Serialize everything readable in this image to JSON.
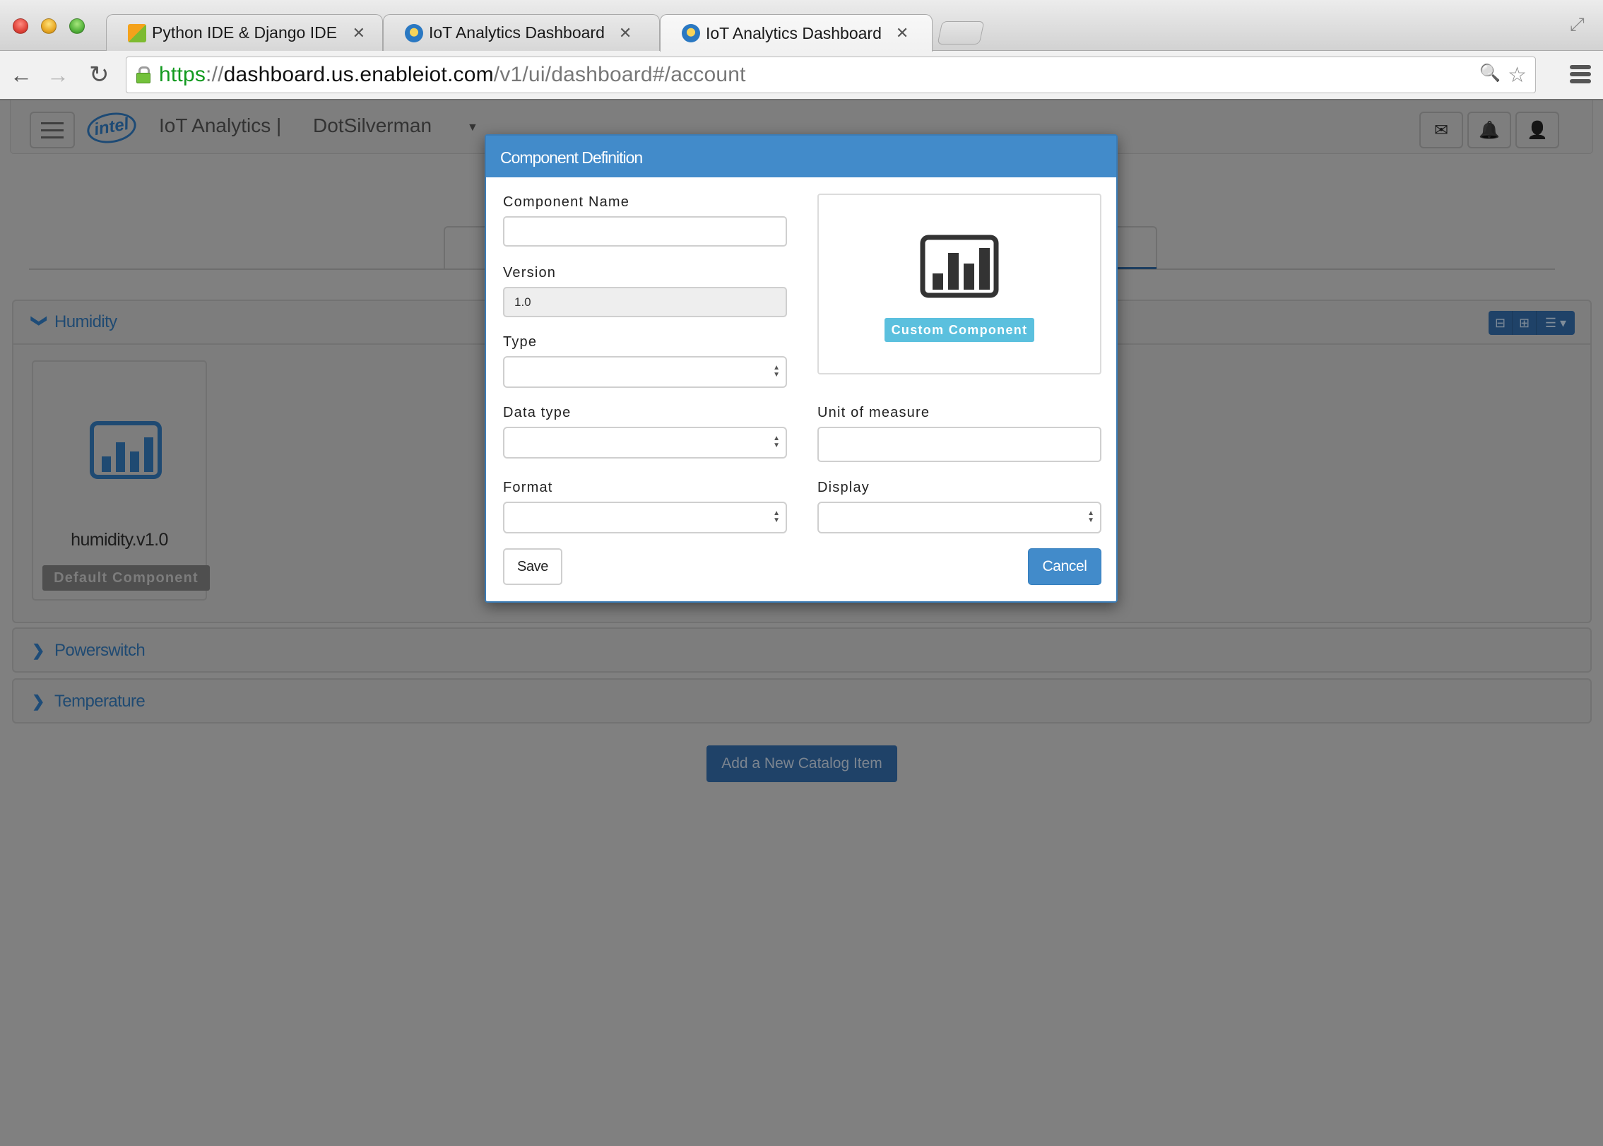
{
  "browser": {
    "tabs": [
      {
        "title": "Python IDE & Django IDE fo",
        "favicon": "pycharm-icon",
        "active": false
      },
      {
        "title": "IoT Analytics Dashboard",
        "favicon": "iot-icon",
        "active": false
      },
      {
        "title": "IoT Analytics Dashboard",
        "favicon": "iot-icon",
        "active": true
      }
    ],
    "tab_close_glyph": "✕",
    "url": {
      "scheme": "https",
      "separator": "://",
      "host": "dashboard.us.enableiot.com",
      "path": "/v1/ui/dashboard#/account"
    },
    "icons": {
      "back": "←",
      "forward": "→",
      "reload": "↻",
      "zoom": "🔍",
      "bookmark": "☆",
      "fullscreen": "⤢"
    }
  },
  "app_header": {
    "logo_text": "intel",
    "brand": "IoT Analytics |",
    "account_name": "DotSilverman",
    "account_caret": "▼",
    "icons": {
      "mail": "✉",
      "bell": "🔔",
      "user": "👤"
    }
  },
  "catalog": {
    "panels": [
      {
        "title": "Humidity",
        "expanded": true,
        "chevron": "❯"
      },
      {
        "title": "Powerswitch",
        "expanded": false,
        "chevron": "❯"
      },
      {
        "title": "Temperature",
        "expanded": false,
        "chevron": "❯"
      }
    ],
    "panel_tools": {
      "collapse": "⊟",
      "expand": "⊞",
      "list": "☰ ▾"
    },
    "components": [
      {
        "name": "humidity.v1.0",
        "badge": "Default Component"
      }
    ],
    "add_button": "Add a New Catalog Item"
  },
  "modal": {
    "title": "Component Definition",
    "fields": {
      "component_name": {
        "label": "Component Name",
        "value": "",
        "placeholder": ""
      },
      "version": {
        "label": "Version",
        "value": "1.0"
      },
      "type": {
        "label": "Type",
        "value": ""
      },
      "data_type": {
        "label": "Data type",
        "value": ""
      },
      "unit_of_measure": {
        "label": "Unit of measure",
        "value": "",
        "placeholder": ""
      },
      "format": {
        "label": "Format",
        "value": ""
      },
      "display": {
        "label": "Display",
        "value": ""
      }
    },
    "preview_badge": "Custom Component",
    "save_label": "Save",
    "cancel_label": "Cancel"
  },
  "colors": {
    "primary": "#428bca",
    "info": "#5bc0de",
    "overlay_bg": "#808080",
    "panel_title": "#1f4a72"
  }
}
